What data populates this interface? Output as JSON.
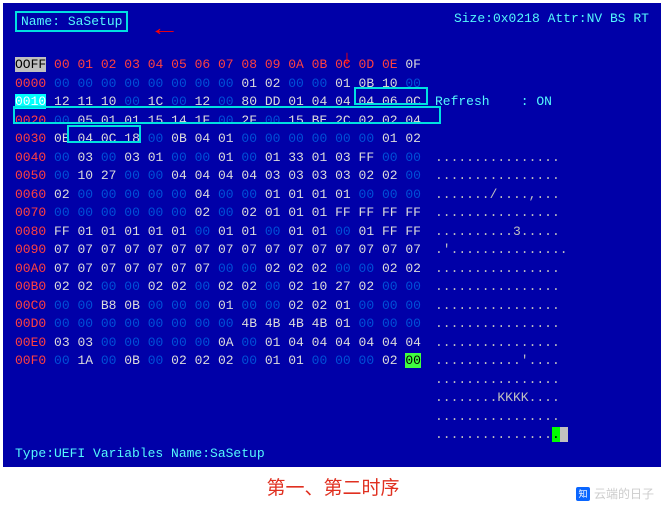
{
  "header": {
    "name_label": "Name:",
    "name_value": "SaSetup",
    "size_attr": "Size:0x0218 Attr:NV BS RT"
  },
  "hex_header": {
    "offset_cell": "OOFF",
    "cols": [
      "00",
      "01",
      "02",
      "03",
      "04",
      "05",
      "06",
      "07",
      "08",
      "09",
      "0A",
      "0B",
      "0C",
      "0D",
      "0E"
    ],
    "last_col": "0F"
  },
  "side": {
    "refresh": "Refresh    : ON"
  },
  "rows": [
    {
      "off": "0000",
      "b": [
        "00",
        "00",
        "00",
        "00",
        "00",
        "00",
        "00",
        "00",
        "01",
        "02",
        "00",
        "00",
        "01",
        "0B",
        "10",
        "00"
      ],
      "asc": "................"
    },
    {
      "off": "0010",
      "b": [
        "12",
        "11",
        "10",
        "00",
        "1C",
        "00",
        "12",
        "00",
        "80",
        "DD",
        "01",
        "04",
        "04",
        "04",
        "06",
        "0C"
      ],
      "asc": "................"
    },
    {
      "off": "0020",
      "b": [
        "00",
        "05",
        "01",
        "01",
        "15",
        "14",
        "1F",
        "00",
        "2F",
        "00",
        "15",
        "BE",
        "2C",
        "02",
        "02",
        "04"
      ],
      "asc": "......./....,..."
    },
    {
      "off": "0030",
      "b": [
        "0B",
        "04",
        "0C",
        "18",
        "00",
        "0B",
        "04",
        "01",
        "00",
        "00",
        "00",
        "00",
        "00",
        "00",
        "01",
        "02"
      ],
      "asc": "................"
    },
    {
      "off": "0040",
      "b": [
        "00",
        "03",
        "00",
        "03",
        "01",
        "00",
        "00",
        "01",
        "00",
        "01",
        "33",
        "01",
        "03",
        "FF",
        "00",
        "00"
      ],
      "asc": "..........3....."
    },
    {
      "off": "0050",
      "b": [
        "00",
        "10",
        "27",
        "00",
        "00",
        "04",
        "04",
        "04",
        "04",
        "03",
        "03",
        "03",
        "03",
        "02",
        "02",
        "00"
      ],
      "asc": ".'..............."
    },
    {
      "off": "0060",
      "b": [
        "02",
        "00",
        "00",
        "00",
        "00",
        "00",
        "04",
        "00",
        "00",
        "01",
        "01",
        "01",
        "01",
        "00",
        "00",
        "00"
      ],
      "asc": "................"
    },
    {
      "off": "0070",
      "b": [
        "00",
        "00",
        "00",
        "00",
        "00",
        "00",
        "02",
        "00",
        "02",
        "01",
        "01",
        "01",
        "FF",
        "FF",
        "FF",
        "FF"
      ],
      "asc": "................"
    },
    {
      "off": "0080",
      "b": [
        "FF",
        "01",
        "01",
        "01",
        "01",
        "01",
        "00",
        "01",
        "01",
        "00",
        "01",
        "01",
        "00",
        "01",
        "FF",
        "FF"
      ],
      "asc": "................"
    },
    {
      "off": "0090",
      "b": [
        "07",
        "07",
        "07",
        "07",
        "07",
        "07",
        "07",
        "07",
        "07",
        "07",
        "07",
        "07",
        "07",
        "07",
        "07",
        "07"
      ],
      "asc": "................"
    },
    {
      "off": "00A0",
      "b": [
        "07",
        "07",
        "07",
        "07",
        "07",
        "07",
        "07",
        "00",
        "00",
        "02",
        "02",
        "02",
        "00",
        "00",
        "02",
        "02"
      ],
      "asc": "................"
    },
    {
      "off": "00B0",
      "b": [
        "02",
        "02",
        "00",
        "00",
        "02",
        "02",
        "00",
        "02",
        "02",
        "00",
        "02",
        "10",
        "27",
        "02",
        "00",
        "00"
      ],
      "asc": "...........'...."
    },
    {
      "off": "00C0",
      "b": [
        "00",
        "00",
        "B8",
        "0B",
        "00",
        "00",
        "00",
        "01",
        "00",
        "00",
        "02",
        "02",
        "01",
        "00",
        "00",
        "00"
      ],
      "asc": "................"
    },
    {
      "off": "00D0",
      "b": [
        "00",
        "00",
        "00",
        "00",
        "00",
        "00",
        "00",
        "00",
        "4B",
        "4B",
        "4B",
        "4B",
        "01",
        "00",
        "00",
        "00"
      ],
      "asc": "........KKKK...."
    },
    {
      "off": "00E0",
      "b": [
        "03",
        "03",
        "00",
        "00",
        "00",
        "00",
        "00",
        "0A",
        "00",
        "01",
        "04",
        "04",
        "04",
        "04",
        "04",
        "04"
      ],
      "asc": "................"
    },
    {
      "off": "00F0",
      "b": [
        "00",
        "1A",
        "00",
        "0B",
        "00",
        "02",
        "02",
        "02",
        "00",
        "01",
        "01",
        "00",
        "00",
        "00",
        "02",
        "00"
      ],
      "asc": "................"
    }
  ],
  "footer": {
    "type_line": "Type:UEFI Variables  Name:SaSetup"
  },
  "caption": "第一、第二时序",
  "watermark": "云端的日子"
}
